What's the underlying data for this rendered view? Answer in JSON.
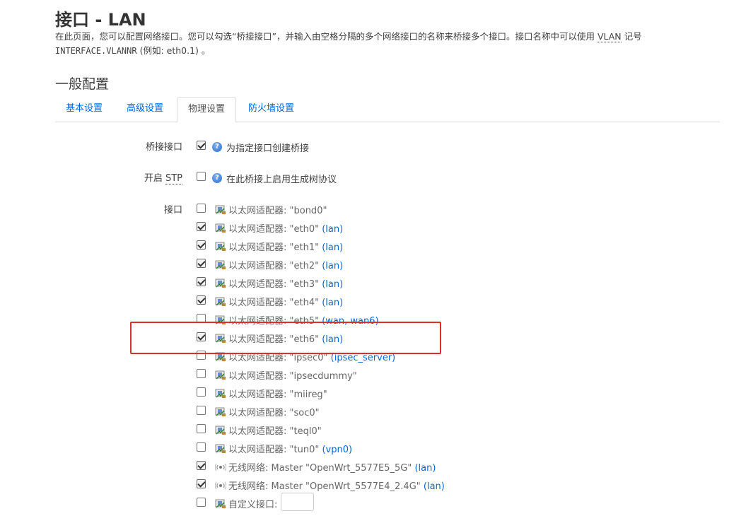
{
  "header": {
    "title": "接口 - LAN",
    "desc_line1_pre": "在此页面，您可以配置网络接口。您可以勾选“桥接接口”，并输入由空格分隔的多个网络接口的名称来桥接多个接口。接口名称中可以使用 ",
    "desc_abbr": "VLAN",
    "desc_line1_post": " 记号",
    "desc_line2_mono": "INTERFACE.VLANNR",
    "desc_line2_rest": " (例如: eth0.1) 。"
  },
  "section_title": "一般配置",
  "tabs": [
    {
      "label": "基本设置"
    },
    {
      "label": "高级设置"
    },
    {
      "label": "物理设置"
    },
    {
      "label": "防火墙设置"
    }
  ],
  "bridge": {
    "label": "桥接接口",
    "checked": true,
    "option": "为指定接口创建桥接"
  },
  "stp": {
    "label_pre": "开启 ",
    "label_abbr": "STP",
    "checked": false,
    "option": "在此桥接上启用生成树协议"
  },
  "interfaces_label": "接口",
  "interfaces": [
    {
      "text": "以太网适配器: \"bond0\"",
      "net": "",
      "checked": false,
      "type": "eth"
    },
    {
      "text": "以太网适配器: \"eth0\" ",
      "net": "(lan)",
      "checked": true,
      "type": "eth"
    },
    {
      "text": "以太网适配器: \"eth1\" ",
      "net": "(lan)",
      "checked": true,
      "type": "eth"
    },
    {
      "text": "以太网适配器: \"eth2\" ",
      "net": "(lan)",
      "checked": true,
      "type": "eth"
    },
    {
      "text": "以太网适配器: \"eth3\" ",
      "net": "(lan)",
      "checked": true,
      "type": "eth"
    },
    {
      "text": "以太网适配器: \"eth4\" ",
      "net": "(lan)",
      "checked": true,
      "type": "eth"
    },
    {
      "text": "以太网适配器: \"eth5\" ",
      "net": "(wan, wan6)",
      "checked": false,
      "type": "eth"
    },
    {
      "text": "以太网适配器: \"eth6\" ",
      "net": "(lan)",
      "checked": true,
      "type": "eth"
    },
    {
      "text": "以太网适配器: \"ipsec0\" ",
      "net": "(ipsec_server)",
      "checked": false,
      "type": "eth"
    },
    {
      "text": "以太网适配器: \"ipsecdummy\"",
      "net": "",
      "checked": false,
      "type": "eth"
    },
    {
      "text": "以太网适配器: \"miireg\"",
      "net": "",
      "checked": false,
      "type": "eth"
    },
    {
      "text": "以太网适配器: \"soc0\"",
      "net": "",
      "checked": false,
      "type": "eth"
    },
    {
      "text": "以太网适配器: \"teql0\"",
      "net": "",
      "checked": false,
      "type": "eth"
    },
    {
      "text": "以太网适配器: \"tun0\" ",
      "net": "(vpn0)",
      "checked": false,
      "type": "eth"
    },
    {
      "text": "无线网络: Master \"OpenWrt_5577E5_5G\" ",
      "net": "(lan)",
      "checked": true,
      "type": "wifi"
    },
    {
      "text": "无线网络: Master \"OpenWrt_5577E4_2.4G\" ",
      "net": "(lan)",
      "checked": true,
      "type": "wifi"
    },
    {
      "text": "自定义接口:",
      "net": "",
      "checked": false,
      "type": "custom"
    }
  ],
  "colors": {
    "link": "#0069d6",
    "highlight": "#d9302c"
  }
}
